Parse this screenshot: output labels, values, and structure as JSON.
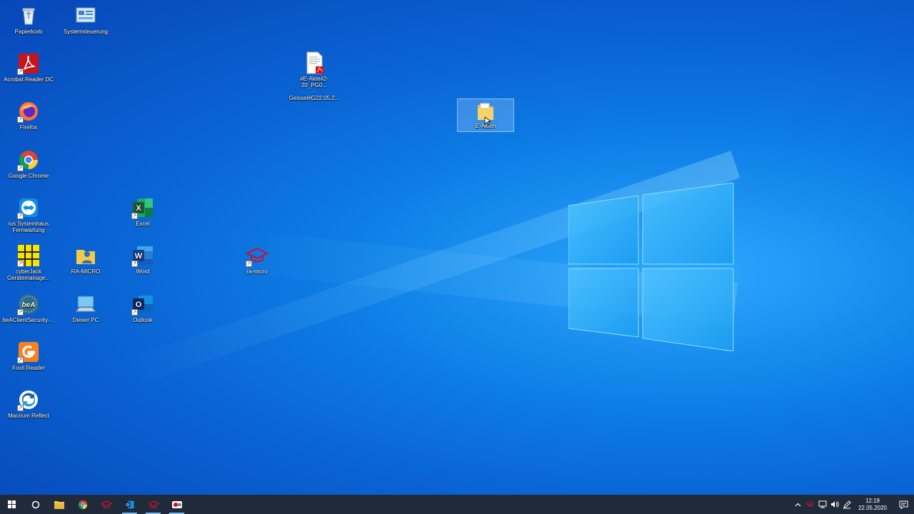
{
  "desktop_icons": {
    "papierkorb": "Papierkorb",
    "systemsteuerung": "Systemsteuerung",
    "acrobat": "Acrobat Reader DC",
    "firefox": "Firefox",
    "chrome": "Google Chrome",
    "teamviewer_line1": "ius Systemhaus",
    "teamviewer_line2": "Fernwartung",
    "cyberjack_line1": "cyberJack",
    "cyberjack_line2": "Gerätemanage...",
    "bea": "beAClientSecurity-...",
    "foxit": "Foxit Reader",
    "macrium": "Macrium Reflect",
    "ramicro": "RA-MICRO",
    "dieser_pc": "Dieser PC",
    "excel": "Excel",
    "word": "Word",
    "outlook": "Outlook",
    "ra_micro_short": "ra-micro",
    "pdf_file_line1": "#E-Akte#2-20_PG0...",
    "pdf_file_line2": "- Geissel#G22.05.2...",
    "eakten_folder": "E-Akten"
  },
  "tray": {
    "time": "12:19",
    "date": "22.05.2020"
  },
  "colors": {
    "taskbar": "#1f2b3a",
    "desktop_accent": "#0d7ee6"
  }
}
